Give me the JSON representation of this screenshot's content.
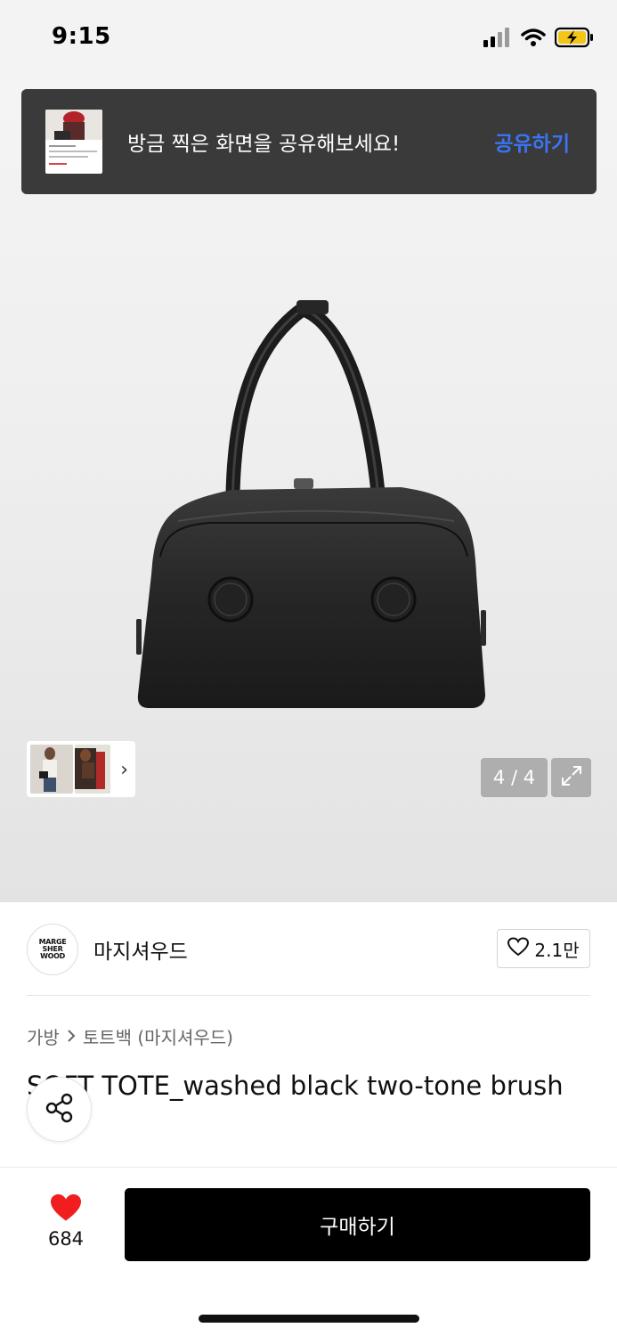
{
  "status_bar": {
    "time": "9:15",
    "icons": [
      "signal-icon",
      "wifi-icon",
      "battery-charging-icon"
    ]
  },
  "toast": {
    "message": "방금 찍은 화면을 공유해보세요!",
    "action_label": "공유하기",
    "action_color": "#3b74f2"
  },
  "gallery": {
    "counter": "4 / 4",
    "thumbnail_strip_chevron": "›"
  },
  "brand": {
    "logo_lines": [
      "MARGE",
      "SHER",
      "WOOD"
    ],
    "name": "마지셔우드",
    "like_count": "2.1만"
  },
  "breadcrumb": {
    "items": [
      "가방",
      "토트백 (마지셔우드)"
    ]
  },
  "product": {
    "title": "SOFT TOTE_washed black two-tone brush"
  },
  "bottom_bar": {
    "wish_count": "684",
    "buy_label": "구매하기",
    "heart_color": "#f01e1e"
  }
}
